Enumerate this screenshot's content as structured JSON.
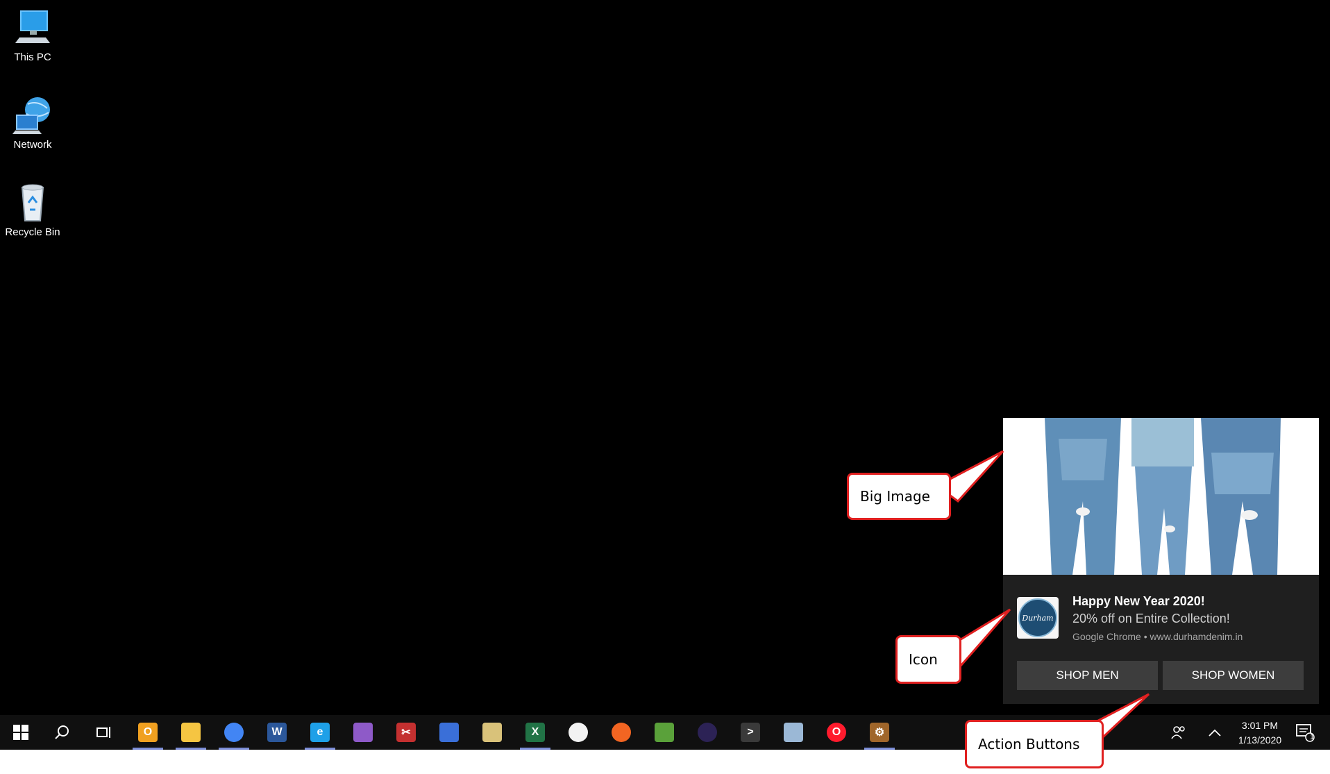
{
  "desktop": {
    "icons": [
      {
        "label": "This PC",
        "icon": "computer-icon"
      },
      {
        "label": "Network",
        "icon": "network-icon"
      },
      {
        "label": "Recycle Bin",
        "icon": "recycle-bin-icon"
      }
    ]
  },
  "toast": {
    "title": "Happy New Year 2020!",
    "body": "20% off on Entire Collection!",
    "attribution": "Google Chrome • www.durhamdenim.in",
    "icon_text": "Durham",
    "buttons": [
      "SHOP MEN",
      "SHOP WOMEN"
    ]
  },
  "taskbar": {
    "apps": [
      {
        "icon": "outlook-icon",
        "glyph": "O",
        "color": "#f0a020",
        "active": true
      },
      {
        "icon": "file-explorer-icon",
        "glyph": "",
        "color": "#f5c542",
        "active": true
      },
      {
        "icon": "chrome-icon",
        "glyph": "",
        "color": "#4285f4",
        "active": true
      },
      {
        "icon": "word-icon",
        "glyph": "W",
        "color": "#2b579a",
        "active": false
      },
      {
        "icon": "internet-explorer-icon",
        "glyph": "e",
        "color": "#1ea0e8",
        "active": true
      },
      {
        "icon": "purple-app-icon",
        "glyph": "",
        "color": "#8e5ac8",
        "active": false
      },
      {
        "icon": "snipping-tool-icon",
        "glyph": "✂",
        "color": "#c43030",
        "active": false
      },
      {
        "icon": "remote-desktop-icon",
        "glyph": "",
        "color": "#3a6fd8",
        "active": false
      },
      {
        "icon": "paint-icon",
        "glyph": "",
        "color": "#d9c27a",
        "active": false
      },
      {
        "icon": "excel-icon",
        "glyph": "X",
        "color": "#217346",
        "active": true
      },
      {
        "icon": "red-circle-app-icon",
        "glyph": "",
        "color": "#f2f2f2",
        "active": false
      },
      {
        "icon": "orange-app-icon",
        "glyph": "",
        "color": "#f26522",
        "active": false
      },
      {
        "icon": "green-editor-icon",
        "glyph": "",
        "color": "#5aa13a",
        "active": false
      },
      {
        "icon": "eclipse-icon",
        "glyph": "",
        "color": "#2c2255",
        "active": false
      },
      {
        "icon": "terminal-icon",
        "glyph": ">",
        "color": "#3a3a3a",
        "active": false
      },
      {
        "icon": "database-icon",
        "glyph": "",
        "color": "#9bb8d6",
        "active": false
      },
      {
        "icon": "opera-icon",
        "glyph": "O",
        "color": "#ff1b2d",
        "active": false
      },
      {
        "icon": "gear-app-icon",
        "glyph": "⚙",
        "color": "#a0662a",
        "active": true
      }
    ],
    "time": "3:01 PM",
    "date": "1/13/2020",
    "notification_count": "1"
  },
  "callouts": {
    "big_image": "Big Image",
    "icon": "Icon",
    "action_buttons": "Action Buttons"
  }
}
